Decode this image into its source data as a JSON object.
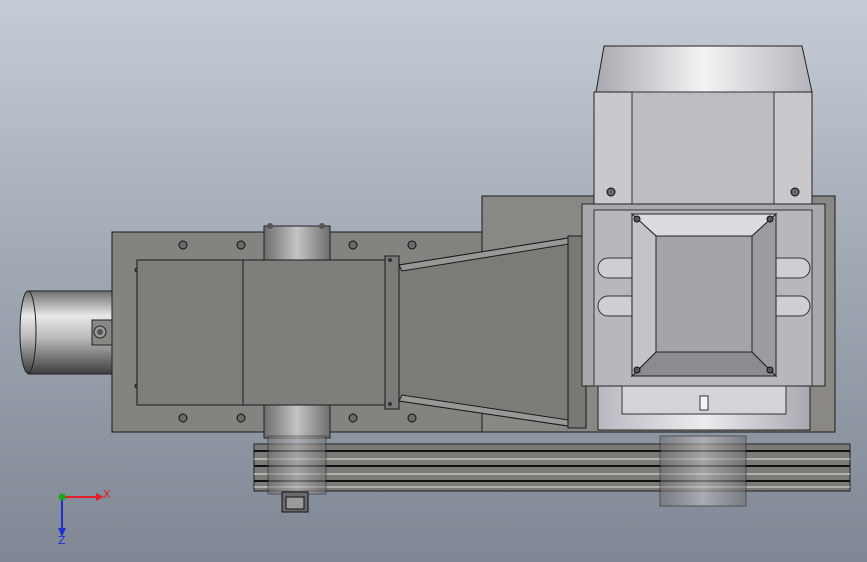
{
  "viewport": {
    "background_top": "#c6ccd5",
    "background_mid": "#9aa3b0",
    "background_bottom": "#7f8794"
  },
  "model": {
    "steel_color": "#8c8a88",
    "steel_dark": "#5a5a5a",
    "outline_color": "#1a1a1a",
    "motor_color": "#d8d8dc",
    "belt_color": "#3c3c3c"
  },
  "triad": {
    "x_label": "X",
    "z_label": "Z",
    "x_color": "#e0202a",
    "y_color": "#1aa61a",
    "z_color": "#2030d0"
  }
}
